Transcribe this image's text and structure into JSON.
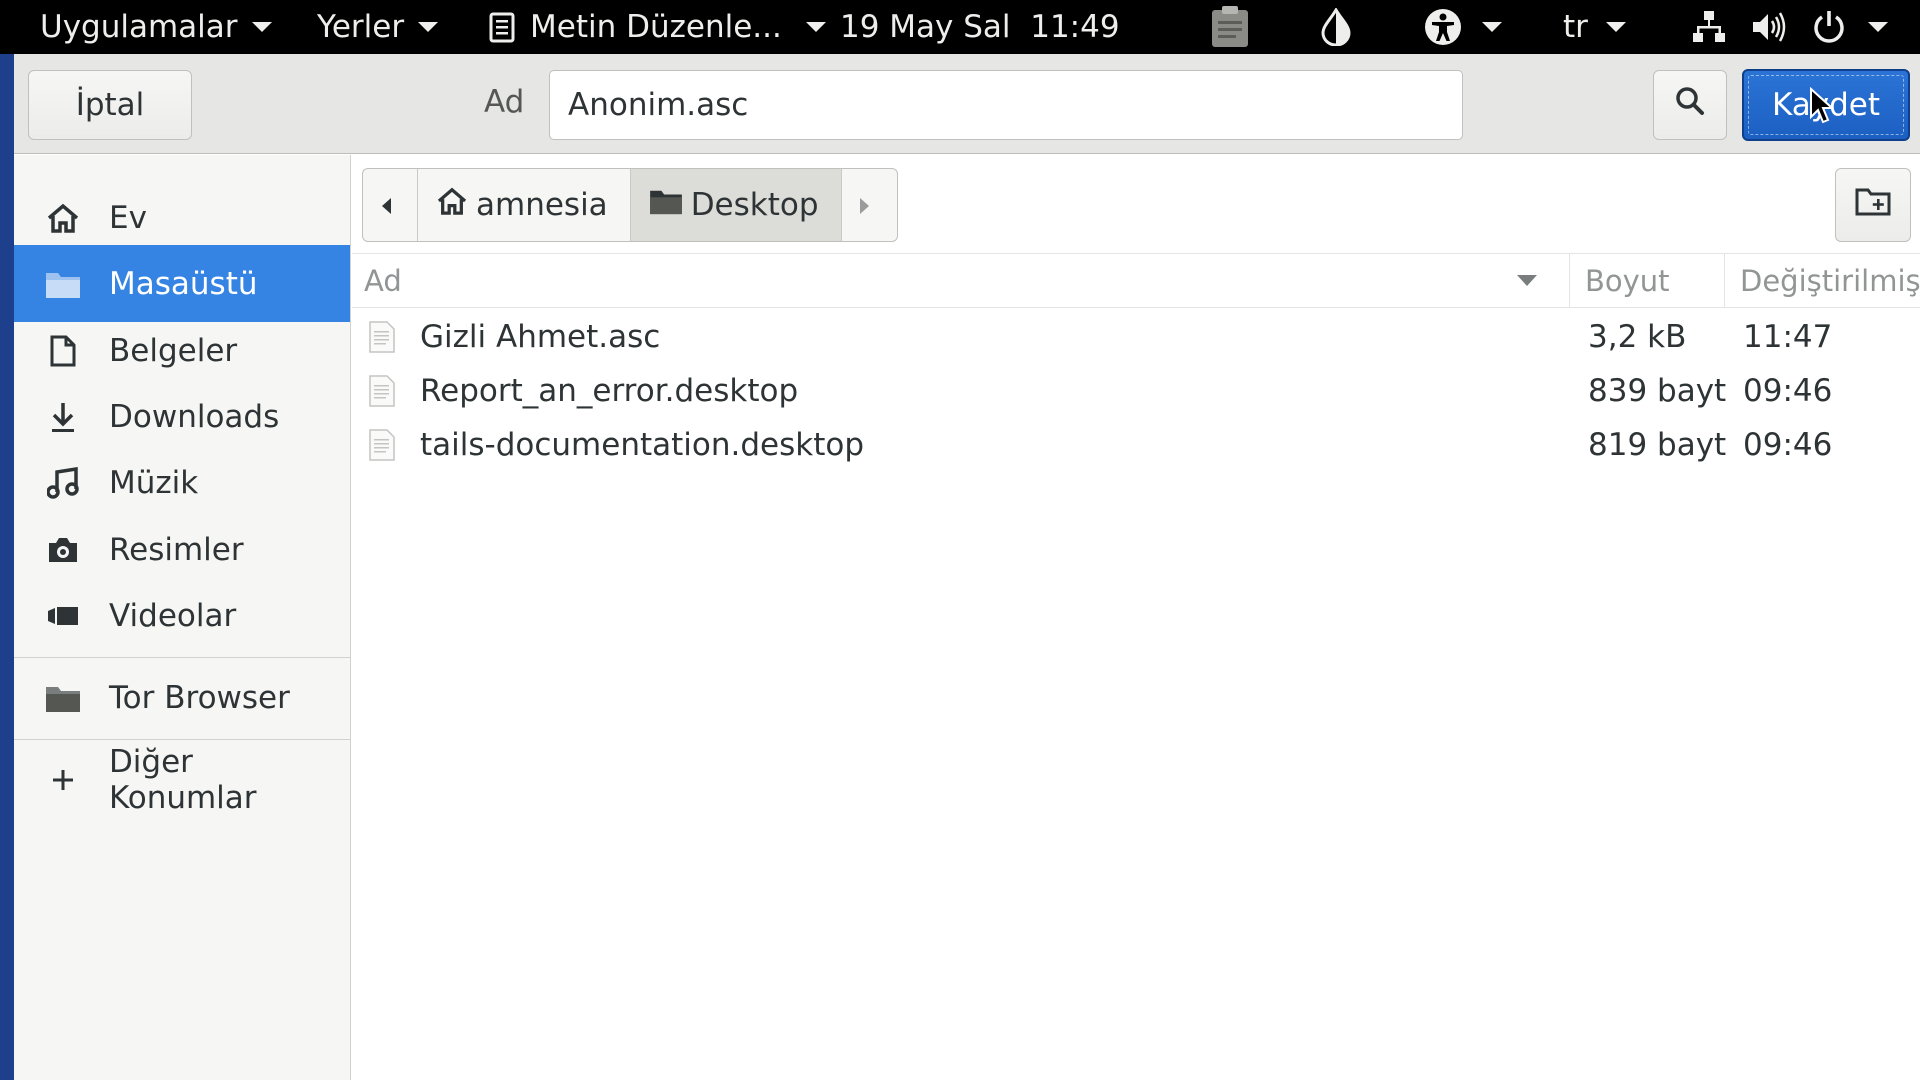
{
  "topbar": {
    "applications": "Uygulamalar",
    "places": "Yerler",
    "current_app": "Metin Düzenle...",
    "datetime": "19 May Sal  11:49",
    "keyboard_layout": "tr",
    "icons": [
      "text-editor-icon",
      "clipboard-icon",
      "keepassxc-drop-icon",
      "accessibility-icon",
      "network-icon",
      "volume-icon",
      "power-icon"
    ]
  },
  "dialog": {
    "cancel_label": "İptal",
    "name_label": "Ad",
    "filename": "Anonim.asc",
    "save_label": "Kaydet"
  },
  "sidebar": {
    "items": [
      {
        "label": "Ev",
        "icon": "home-icon"
      },
      {
        "label": "Masaüstü",
        "icon": "folder-icon",
        "active": true
      },
      {
        "label": "Belgeler",
        "icon": "document-icon"
      },
      {
        "label": "Downloads",
        "icon": "download-icon"
      },
      {
        "label": "Müzik",
        "icon": "music-icon"
      },
      {
        "label": "Resimler",
        "icon": "camera-icon"
      },
      {
        "label": "Videolar",
        "icon": "video-icon"
      },
      {
        "label": "Tor Browser",
        "icon": "folder-icon"
      },
      {
        "label": "Diğer Konumlar",
        "icon": "plus-icon"
      }
    ]
  },
  "pathbar": {
    "crumbs": [
      "amnesia",
      "Desktop"
    ],
    "current": "Desktop"
  },
  "file_list": {
    "columns": [
      "Ad",
      "Boyut",
      "Değiştirilmiş"
    ],
    "sort_column": "Ad",
    "rows": [
      {
        "name": "Gizli Ahmet.asc",
        "size": "3,2 kB",
        "modified": "11:47"
      },
      {
        "name": "Report_an_error.desktop",
        "size": "839 bayt",
        "modified": "09:46"
      },
      {
        "name": "tails-documentation.desktop",
        "size": "819 bayt",
        "modified": "09:46"
      }
    ]
  },
  "colors": {
    "accent": "#3584e4",
    "save_button": "#1c5fc2",
    "topbar": "#000000",
    "desktop_background": "#1d3f8c"
  }
}
